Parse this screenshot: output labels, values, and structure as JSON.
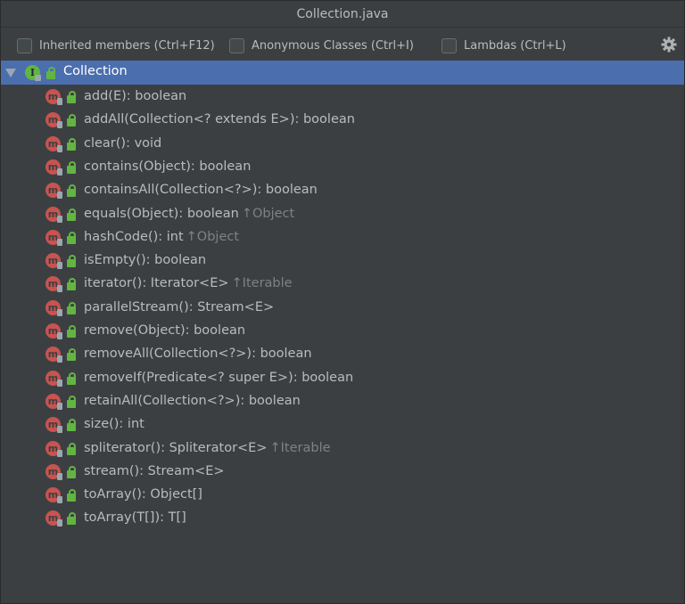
{
  "window": {
    "title": "Collection.java"
  },
  "options": {
    "inherited": "Inherited members (Ctrl+F12)",
    "anonymous": "Anonymous Classes (Ctrl+I)",
    "lambdas": "Lambdas (Ctrl+L)",
    "settings_icon": "gear-icon"
  },
  "tree": {
    "root": {
      "label": "Collection",
      "icon": "interface-icon"
    },
    "members": [
      {
        "sig": "add(E): boolean",
        "inherited": ""
      },
      {
        "sig": "addAll(Collection<? extends E>): boolean",
        "inherited": ""
      },
      {
        "sig": "clear(): void",
        "inherited": ""
      },
      {
        "sig": "contains(Object): boolean",
        "inherited": ""
      },
      {
        "sig": "containsAll(Collection<?>): boolean",
        "inherited": ""
      },
      {
        "sig": "equals(Object): boolean",
        "inherited": "↑Object"
      },
      {
        "sig": "hashCode(): int",
        "inherited": "↑Object"
      },
      {
        "sig": "isEmpty(): boolean",
        "inherited": ""
      },
      {
        "sig": "iterator(): Iterator<E>",
        "inherited": "↑Iterable"
      },
      {
        "sig": "parallelStream(): Stream<E>",
        "inherited": ""
      },
      {
        "sig": "remove(Object): boolean",
        "inherited": ""
      },
      {
        "sig": "removeAll(Collection<?>): boolean",
        "inherited": ""
      },
      {
        "sig": "removeIf(Predicate<? super E>): boolean",
        "inherited": ""
      },
      {
        "sig": "retainAll(Collection<?>): boolean",
        "inherited": ""
      },
      {
        "sig": "size(): int",
        "inherited": ""
      },
      {
        "sig": "spliterator(): Spliterator<E>",
        "inherited": "↑Iterable"
      },
      {
        "sig": "stream(): Stream<E>",
        "inherited": ""
      },
      {
        "sig": "toArray(): Object[]",
        "inherited": ""
      },
      {
        "sig": "toArray(T[]): T[]",
        "inherited": ""
      }
    ]
  },
  "colors": {
    "background": "#3c3f41",
    "selection": "#4b6eaf",
    "method_icon": "#c75450",
    "interface_icon": "#62b543",
    "public_lock": "#62b543",
    "inherited_text": "#808080"
  }
}
